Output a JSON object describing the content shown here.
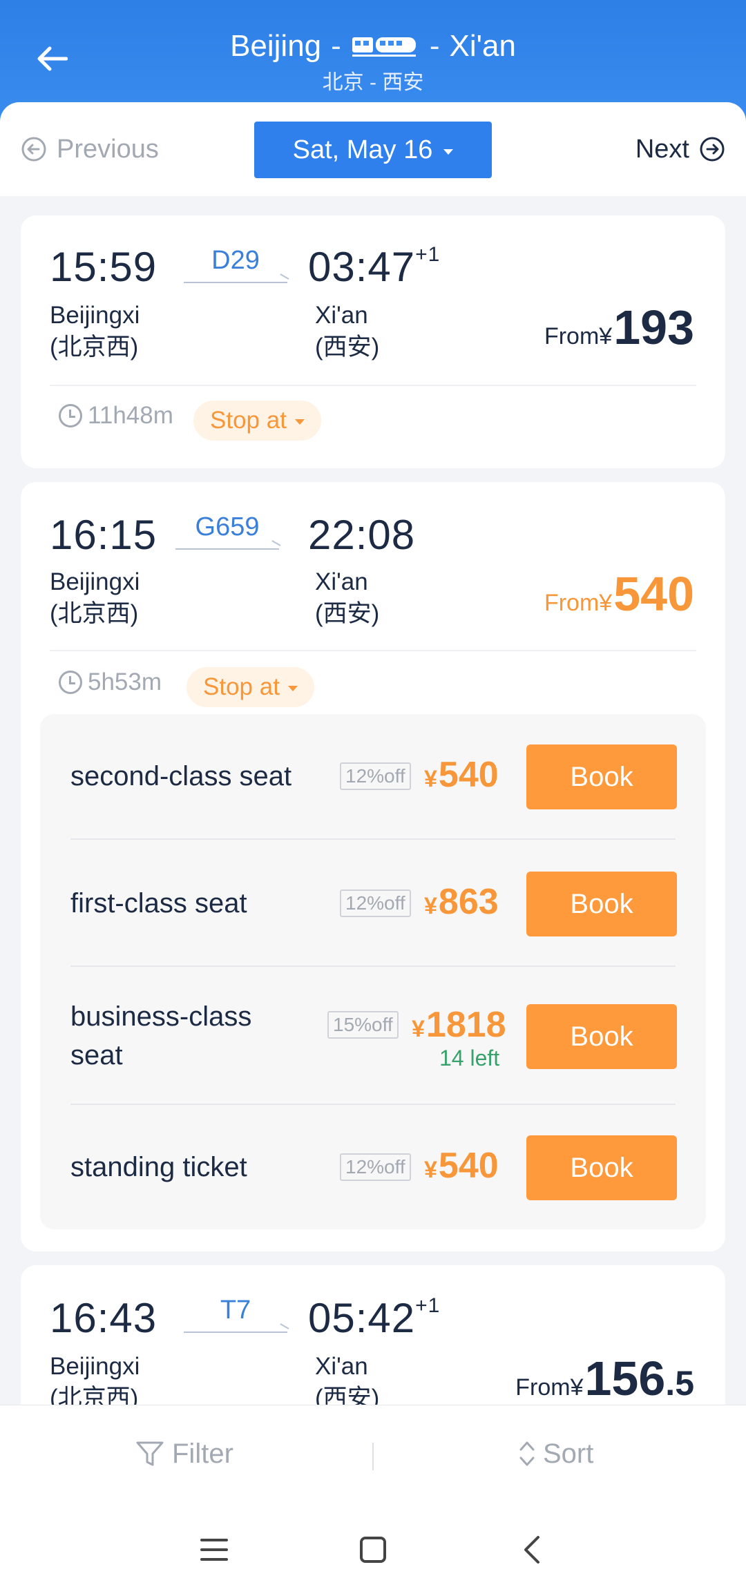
{
  "header": {
    "from": "Beijing",
    "to": "Xi'an",
    "subtitle": "北京 - 西安"
  },
  "date_bar": {
    "previous": "Previous",
    "date": "Sat, May 16",
    "next": "Next"
  },
  "trains": [
    {
      "dep_time": "15:59",
      "train_no": "D29",
      "arr_time": "03:47",
      "day_offset": "+1",
      "dep_station": "Beijingxi",
      "dep_station_cn": "(北京西)",
      "arr_station": "Xi'an",
      "arr_station_cn": "(西安)",
      "from_label": "From",
      "currency": "¥",
      "price": "193",
      "duration": "11h48m",
      "stop_label": "Stop at"
    },
    {
      "dep_time": "16:15",
      "train_no": "G659",
      "arr_time": "22:08",
      "dep_station": "Beijingxi",
      "dep_station_cn": "(北京西)",
      "arr_station": "Xi'an",
      "arr_station_cn": "(西安)",
      "from_label": "From",
      "currency": "¥",
      "price": "540",
      "duration": "5h53m",
      "stop_label": "Stop at",
      "seats": [
        {
          "name": "second-class seat",
          "discount": "12%off",
          "price": "540",
          "book": "Book"
        },
        {
          "name": "first-class seat",
          "discount": "12%off",
          "price": "863",
          "book": "Book"
        },
        {
          "name": "business-class seat",
          "discount": "15%off",
          "price": "1818",
          "left": "14 left",
          "book": "Book"
        },
        {
          "name": "standing ticket",
          "discount": "12%off",
          "price": "540",
          "book": "Book"
        }
      ]
    },
    {
      "dep_time": "16:43",
      "train_no": "T7",
      "arr_time": "05:42",
      "day_offset": "+1",
      "dep_station": "Beijingxi",
      "dep_station_cn": "(北京西)",
      "arr_station": "Xi'an",
      "arr_station_cn": "(西安)",
      "from_label": "From",
      "currency": "¥",
      "price": "156",
      "price_decimal": ".5"
    }
  ],
  "bottom_bar": {
    "filter": "Filter",
    "sort": "Sort"
  },
  "colors": {
    "header_blue": "#2e7fe6",
    "accent_orange": "#f7973a",
    "book_orange": "#ff9a3c",
    "train_no_blue": "#3a7fd8",
    "seats_left_green": "#36a36a"
  },
  "icons": [
    "back-arrow-icon",
    "train-icon",
    "previous-circle-icon",
    "next-circle-icon",
    "clock-icon",
    "filter-icon",
    "sort-icon",
    "menu-icon",
    "home-square-icon",
    "back-chevron-icon"
  ]
}
